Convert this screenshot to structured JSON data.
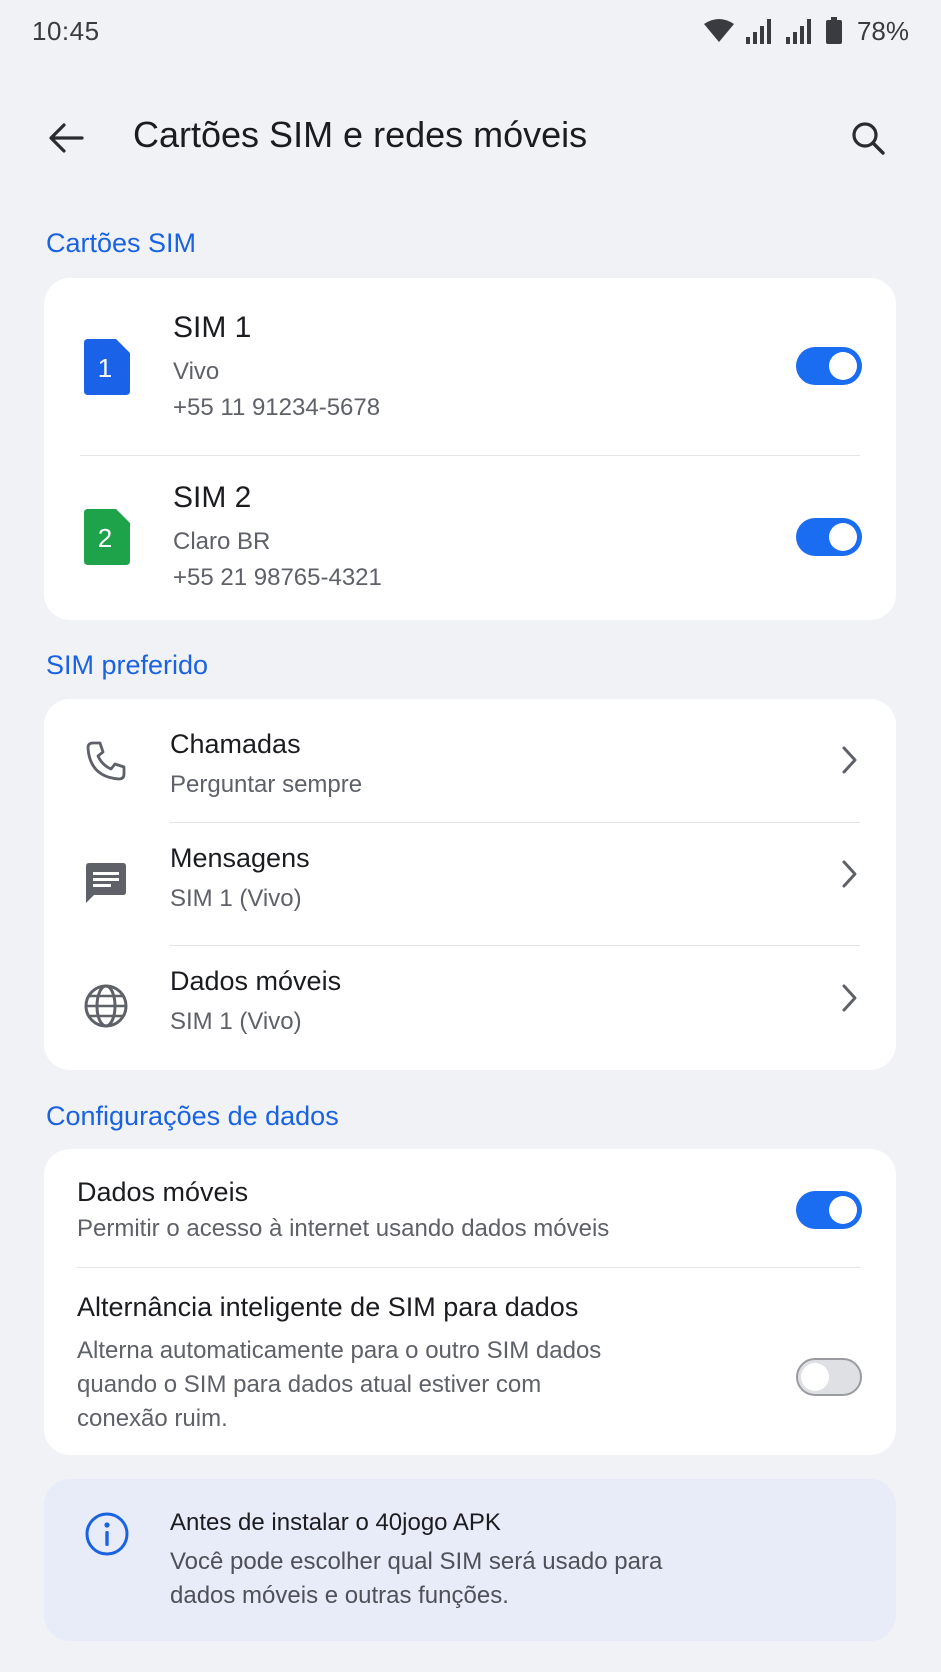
{
  "status_bar": {
    "time": "10:45",
    "battery": "78%",
    "icons": [
      "wifi-icon",
      "signal-icon",
      "signal-icon",
      "battery-icon"
    ]
  },
  "app_bar": {
    "title": "Cartões SIM e redes móveis",
    "back_icon": "arrow-left-icon",
    "search_icon": "search-icon"
  },
  "sections": {
    "sim_cards": "Cartões SIM",
    "preferred_sim": "SIM preferido",
    "data_settings": "Configurações de dados"
  },
  "sims": [
    {
      "badge": "1",
      "name": "SIM 1",
      "carrier": "Vivo",
      "number": "+55 11 91234-5678",
      "enabled": true,
      "color": "#1a63e8"
    },
    {
      "badge": "2",
      "name": "SIM 2",
      "carrier": "Claro BR",
      "number": "+55 21 98765-4321",
      "enabled": true,
      "color": "#1ea34a"
    }
  ],
  "preferred": [
    {
      "icon": "phone-icon",
      "title": "Chamadas",
      "value": "Perguntar sempre"
    },
    {
      "icon": "message-icon",
      "title": "Mensagens",
      "value": "SIM 1 (Vivo)"
    },
    {
      "icon": "globe-icon",
      "title": "Dados móveis",
      "value": "SIM 1 (Vivo)"
    }
  ],
  "data_settings": [
    {
      "title": "Dados móveis",
      "description": "Permitir o acesso à internet usando dados móveis",
      "enabled": true
    },
    {
      "title": "Alternância inteligente de SIM para dados",
      "description": "Alterna automaticamente para o outro SIM dados quando o SIM para dados atual estiver com conexão ruim.",
      "enabled": false
    }
  ],
  "info": {
    "icon": "info-icon",
    "title": "Antes de instalar o 40jogo APK",
    "text": "Você pode escolher qual SIM será usado para dados móveis e outras funções."
  },
  "colors": {
    "accent": "#1a63e0",
    "toggle_on": "#1a6cf0",
    "background": "#f1f2f6",
    "info_bg": "#e8ebf8"
  }
}
